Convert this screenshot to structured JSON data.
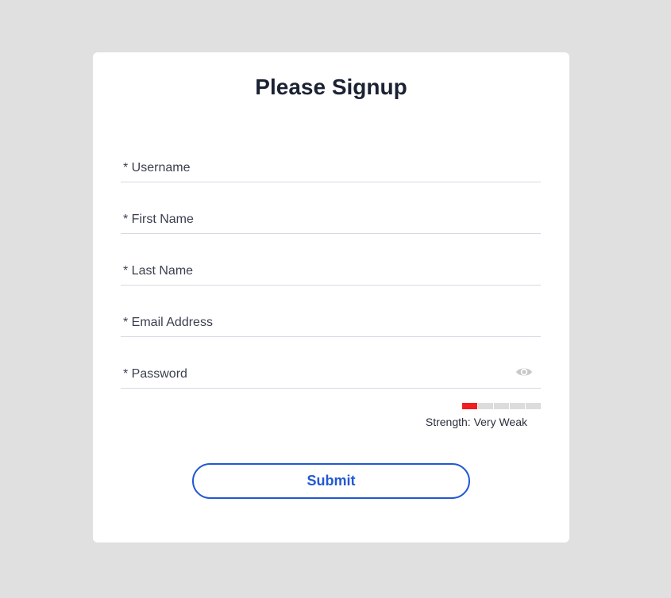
{
  "form": {
    "title": "Please Signup",
    "fields": [
      {
        "name": "username",
        "placeholder": "* Username",
        "value": ""
      },
      {
        "name": "first-name",
        "placeholder": "* First Name",
        "value": ""
      },
      {
        "name": "last-name",
        "placeholder": "* Last Name",
        "value": ""
      },
      {
        "name": "email",
        "placeholder": "* Email Address",
        "value": ""
      },
      {
        "name": "password",
        "placeholder": "* Password",
        "value": ""
      }
    ],
    "password_toggle_icon": "eye-icon",
    "strength": {
      "label": "Strength: Very Weak",
      "level": 1,
      "max": 5,
      "active_color": "#f01e1e",
      "inactive_color": "#dcdcdc"
    },
    "submit_label": "Submit"
  },
  "colors": {
    "background": "#e0e0e0",
    "card": "#ffffff",
    "accent": "#2258d4",
    "title": "#1b2233"
  }
}
